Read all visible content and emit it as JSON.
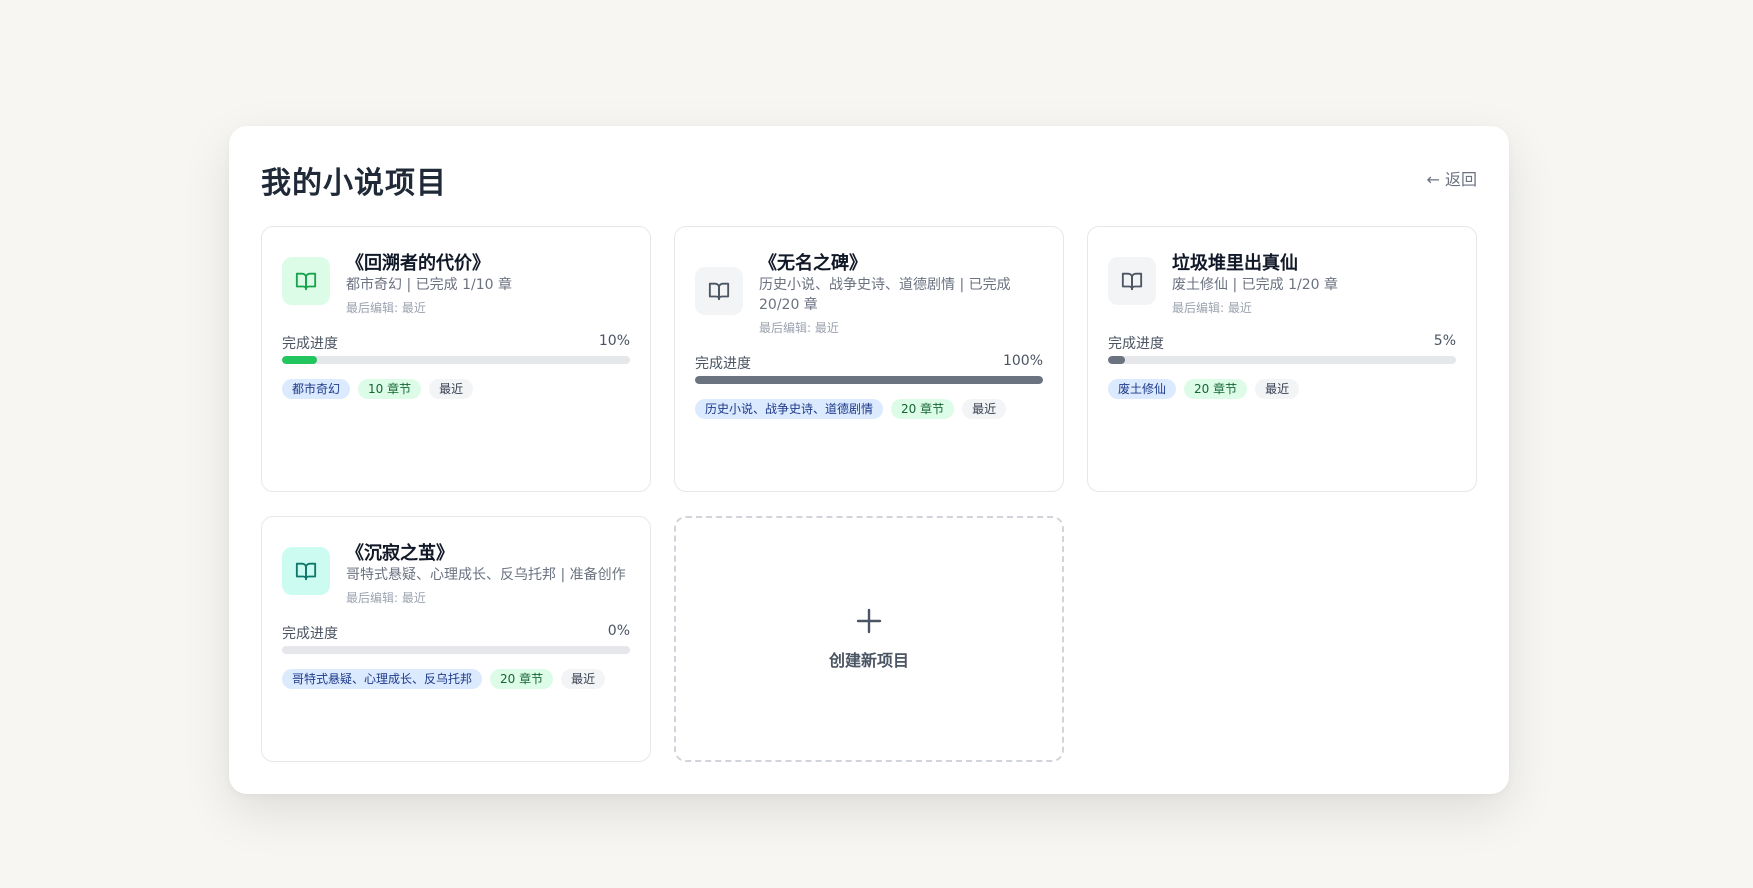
{
  "page": {
    "title": "我的小说项目",
    "back_label": "← 返回"
  },
  "projects": [
    {
      "title": "《回溯者的代价》",
      "meta": "都市奇幻 | 已完成 1/10 章",
      "edited": "最后编辑: 最近",
      "progress_label": "完成进度",
      "progress_text": "10%",
      "progress": 0.1,
      "icon": "book-open-icon",
      "icon_bg": "#dcfce7",
      "icon_color": "#16a34a",
      "bar_color": "#22c55e",
      "tags": {
        "genre": "都市奇幻",
        "chapters": "10 章节",
        "recent": "最近"
      }
    },
    {
      "title": "《无名之碑》",
      "meta": "历史小说、战争史诗、道德剧情 | 已完成 20/20 章",
      "edited": "最后编辑: 最近",
      "progress_label": "完成进度",
      "progress_text": "100%",
      "progress": 1.0,
      "icon": "book-open-icon",
      "icon_bg": "#f3f4f6",
      "icon_color": "#4b5563",
      "bar_color": "#6b7280",
      "tags": {
        "genre": "历史小说、战争史诗、道德剧情",
        "chapters": "20 章节",
        "recent": "最近"
      }
    },
    {
      "title": "垃圾堆里出真仙",
      "meta": "废土修仙 | 已完成 1/20 章",
      "edited": "最后编辑: 最近",
      "progress_label": "完成进度",
      "progress_text": "5%",
      "progress": 0.05,
      "icon": "book-open-icon",
      "icon_bg": "#f3f4f6",
      "icon_color": "#4b5563",
      "bar_color": "#6b7280",
      "tags": {
        "genre": "废土修仙",
        "chapters": "20 章节",
        "recent": "最近"
      }
    },
    {
      "title": "《沉寂之茧》",
      "meta": "哥特式悬疑、心理成长、反乌托邦 | 准备创作",
      "edited": "最后编辑: 最近",
      "progress_label": "完成进度",
      "progress_text": "0%",
      "progress": 0.0,
      "icon": "book-open-icon",
      "icon_bg": "#ccfbf1",
      "icon_color": "#0f766e",
      "bar_color": "#14b8a6",
      "tags": {
        "genre": "哥特式悬疑、心理成长、反乌托邦",
        "chapters": "20 章节",
        "recent": "最近"
      }
    }
  ],
  "new_project": {
    "label": "创建新项目",
    "icon": "plus-icon"
  }
}
